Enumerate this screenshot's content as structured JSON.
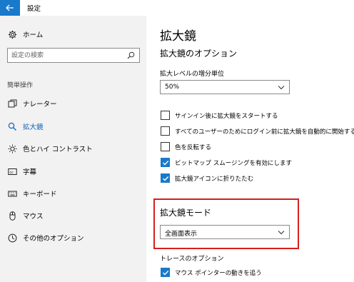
{
  "window": {
    "title": "設定"
  },
  "sidebar": {
    "home_label": "ホーム",
    "search_placeholder": "設定の検索",
    "section_label": "簡単操作",
    "items": [
      {
        "label": "ナレーター",
        "icon": "narrator-icon"
      },
      {
        "label": "拡大鏡",
        "icon": "magnifier-icon",
        "selected": true
      },
      {
        "label": "色とハイ コントラスト",
        "icon": "brightness-icon"
      },
      {
        "label": "字幕",
        "icon": "captions-icon"
      },
      {
        "label": "キーボード",
        "icon": "keyboard-icon"
      },
      {
        "label": "マウス",
        "icon": "mouse-icon"
      },
      {
        "label": "その他のオプション",
        "icon": "other-options-icon"
      }
    ]
  },
  "main": {
    "page_title": "拡大鏡",
    "options_title": "拡大鏡のオプション",
    "zoom_increment_label": "拡大レベルの増分単位",
    "zoom_increment_value": "50%",
    "checkboxes": [
      {
        "label": "サインイン後に拡大鏡をスタートする",
        "checked": false
      },
      {
        "label": "すべてのユーザーのためにログイン前に拡大鏡を自動的に開始する",
        "checked": false
      },
      {
        "label": "色を反転する",
        "checked": false
      },
      {
        "label": "ビットマップ スムージングを有効にします",
        "checked": true
      },
      {
        "label": "拡大鏡アイコンに折りたたむ",
        "checked": true
      }
    ],
    "mode_title": "拡大鏡モード",
    "mode_value": "全画面表示",
    "tracking_title": "トレースのオプション",
    "tracking_checkbox": {
      "label": "マウス ポインターの動きを追う",
      "checked": true
    }
  },
  "colors": {
    "accent": "#1979ca",
    "highlight_frame": "#d81e1e",
    "sidebar_bg": "#f2f2f2"
  }
}
